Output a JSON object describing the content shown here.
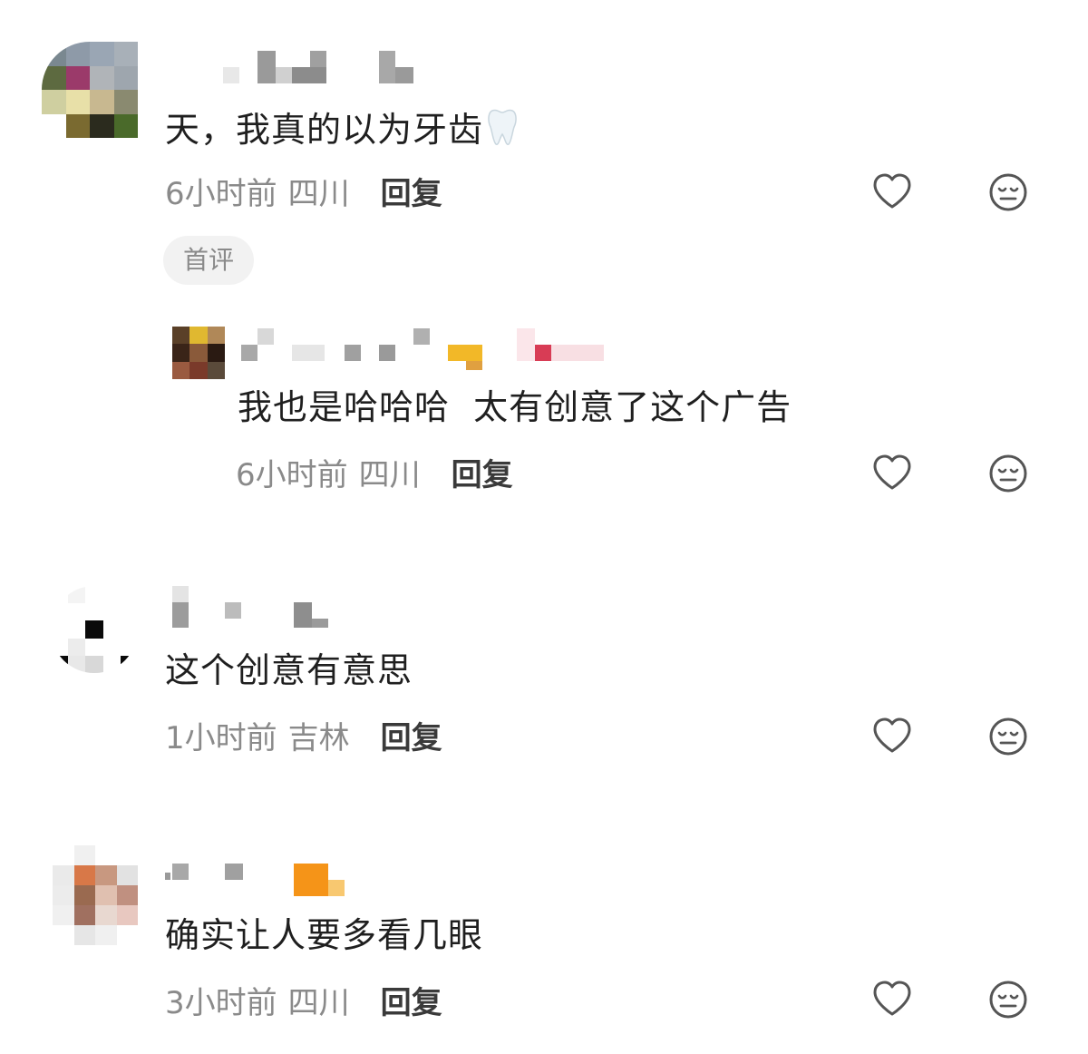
{
  "comments": [
    {
      "content": "天，我真的以为牙齿",
      "emoji": "tooth-emoji",
      "time": "6小时前",
      "location": "四川",
      "reply_label": "回复",
      "badge": "首评",
      "reply": {
        "content": "我也是哈哈哈  太有创意了这个广告",
        "time": "6小时前",
        "location": "四川",
        "reply_label": "回复"
      }
    },
    {
      "content": "这个创意有意思",
      "time": "1小时前",
      "location": "吉林",
      "reply_label": "回复"
    },
    {
      "content": "确实让人要多看几眼",
      "time": "3小时前",
      "location": "四川",
      "reply_label": "回复"
    }
  ],
  "icons": {
    "like": "heart-outline-icon",
    "dislike": "neutral-face-icon"
  },
  "colors": {
    "meta_text": "#8a8a8a",
    "reply_text": "#3a3a3a",
    "content_text": "#1f1f1f",
    "icon_stroke": "#555555",
    "badge_bg": "#f2f2f2"
  }
}
